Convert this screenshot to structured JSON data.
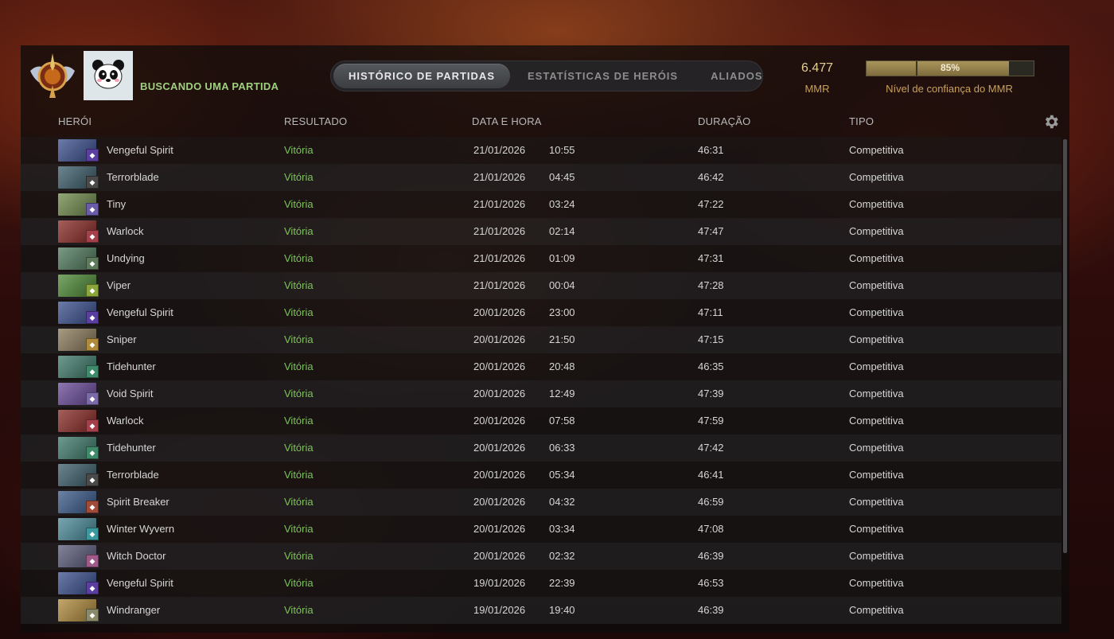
{
  "header": {
    "status_text": "BUSCANDO UMA PARTIDA",
    "tabs": [
      {
        "label": "HISTÓRICO DE PARTIDAS",
        "active": true
      },
      {
        "label": "ESTATÍSTICAS DE HERÓIS",
        "active": false
      },
      {
        "label": "ALIADOS",
        "active": false
      }
    ],
    "mmr_value": "6.477",
    "mmr_label": "MMR",
    "confidence_percent_text": "85%",
    "confidence_fraction": 0.85,
    "confidence_label": "Nível de confiança do MMR"
  },
  "columns": {
    "hero": "HERÓI",
    "result": "RESULTADO",
    "datetime": "DATA E HORA",
    "duration": "DURAÇÃO",
    "type": "TIPO"
  },
  "colors": {
    "win": "#7fc25c",
    "status": "#9fd07f",
    "mmr_gold": "#e3cf94"
  },
  "matches": [
    {
      "hero": "Vengeful Spirit",
      "result": "Vitória",
      "date": "21/01/2026",
      "time": "10:55",
      "duration": "46:31",
      "type": "Competitiva",
      "hero_color": "#3a4f8f",
      "attr_color": "#5a3fa0"
    },
    {
      "hero": "Terrorblade",
      "result": "Vitória",
      "date": "21/01/2026",
      "time": "04:45",
      "duration": "46:42",
      "type": "Competitiva",
      "hero_color": "#3b5d6a",
      "attr_color": "#4a4a4a"
    },
    {
      "hero": "Tiny",
      "result": "Vitória",
      "date": "21/01/2026",
      "time": "03:24",
      "duration": "47:22",
      "type": "Competitiva",
      "hero_color": "#6f8a4a",
      "attr_color": "#6a5ca8"
    },
    {
      "hero": "Warlock",
      "result": "Vitória",
      "date": "21/01/2026",
      "time": "02:14",
      "duration": "47:47",
      "type": "Competitiva",
      "hero_color": "#8a2a25",
      "attr_color": "#a3404a"
    },
    {
      "hero": "Undying",
      "result": "Vitória",
      "date": "21/01/2026",
      "time": "01:09",
      "duration": "47:31",
      "type": "Competitiva",
      "hero_color": "#4f7a5c",
      "attr_color": "#5d7a5a"
    },
    {
      "hero": "Viper",
      "result": "Vitória",
      "date": "21/01/2026",
      "time": "00:04",
      "duration": "47:28",
      "type": "Competitiva",
      "hero_color": "#4d8a35",
      "attr_color": "#8aa63a"
    },
    {
      "hero": "Vengeful Spirit",
      "result": "Vitória",
      "date": "20/01/2026",
      "time": "23:00",
      "duration": "47:11",
      "type": "Competitiva",
      "hero_color": "#3a4f8f",
      "attr_color": "#5a3fa0"
    },
    {
      "hero": "Sniper",
      "result": "Vitória",
      "date": "20/01/2026",
      "time": "21:50",
      "duration": "47:15",
      "type": "Competitiva",
      "hero_color": "#8a7a5a",
      "attr_color": "#b08a3a"
    },
    {
      "hero": "Tidehunter",
      "result": "Vitória",
      "date": "20/01/2026",
      "time": "20:48",
      "duration": "46:35",
      "type": "Competitiva",
      "hero_color": "#3e7a6a",
      "attr_color": "#3f8a6a"
    },
    {
      "hero": "Void Spirit",
      "result": "Vitória",
      "date": "20/01/2026",
      "time": "12:49",
      "duration": "47:39",
      "type": "Competitiva",
      "hero_color": "#6a4a9a",
      "attr_color": "#7a6aa8"
    },
    {
      "hero": "Warlock",
      "result": "Vitória",
      "date": "20/01/2026",
      "time": "07:58",
      "duration": "47:59",
      "type": "Competitiva",
      "hero_color": "#8a2a25",
      "attr_color": "#a3404a"
    },
    {
      "hero": "Tidehunter",
      "result": "Vitória",
      "date": "20/01/2026",
      "time": "06:33",
      "duration": "47:42",
      "type": "Competitiva",
      "hero_color": "#3e7a6a",
      "attr_color": "#3f8a6a"
    },
    {
      "hero": "Terrorblade",
      "result": "Vitória",
      "date": "20/01/2026",
      "time": "05:34",
      "duration": "46:41",
      "type": "Competitiva",
      "hero_color": "#3b5d6a",
      "attr_color": "#4a4a4a"
    },
    {
      "hero": "Spirit Breaker",
      "result": "Vitória",
      "date": "20/01/2026",
      "time": "04:32",
      "duration": "46:59",
      "type": "Competitiva",
      "hero_color": "#3a5a8a",
      "attr_color": "#a04a3a"
    },
    {
      "hero": "Winter Wyvern",
      "result": "Vitória",
      "date": "20/01/2026",
      "time": "03:34",
      "duration": "47:08",
      "type": "Competitiva",
      "hero_color": "#4a8a9a",
      "attr_color": "#3a9aa0"
    },
    {
      "hero": "Witch Doctor",
      "result": "Vitória",
      "date": "20/01/2026",
      "time": "02:32",
      "duration": "46:39",
      "type": "Competitiva",
      "hero_color": "#5a5a7a",
      "attr_color": "#a05a8a"
    },
    {
      "hero": "Vengeful Spirit",
      "result": "Vitória",
      "date": "19/01/2026",
      "time": "22:39",
      "duration": "46:53",
      "type": "Competitiva",
      "hero_color": "#3a4f8f",
      "attr_color": "#5a3fa0"
    },
    {
      "hero": "Windranger",
      "result": "Vitória",
      "date": "19/01/2026",
      "time": "19:40",
      "duration": "46:39",
      "type": "Competitiva",
      "hero_color": "#b08a3a",
      "attr_color": "#8a8a6a"
    }
  ]
}
